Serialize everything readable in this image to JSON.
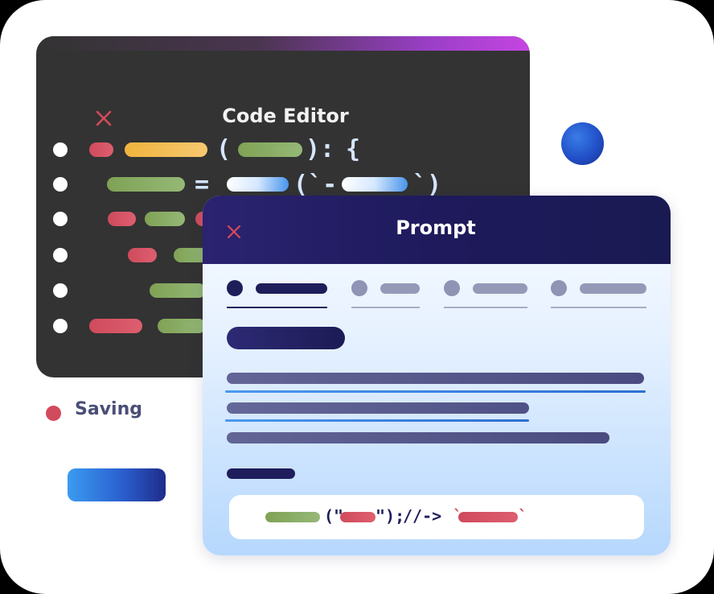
{
  "editor": {
    "title": "Code Editor",
    "close_icon": "close-icon",
    "accent_gradient": [
      "#333333",
      "#c545e2"
    ],
    "lines": [
      {
        "symbols": [
          "(",
          "):",
          "{"
        ]
      },
      {
        "symbols": [
          "=",
          "(`-",
          "`)"
        ]
      },
      {
        "symbols": []
      },
      {
        "symbols": []
      },
      {
        "symbols": []
      },
      {
        "symbols": []
      }
    ]
  },
  "status": {
    "label": "Saving",
    "dot_color": "#d24b5c"
  },
  "prompt": {
    "title": "Prompt",
    "close_icon": "close-icon",
    "header_color": "#1e1a5c",
    "tabs": [
      {
        "state": "active"
      },
      {
        "state": "inactive"
      },
      {
        "state": "inactive"
      },
      {
        "state": "inactive"
      }
    ],
    "code_snippet": {
      "open": "(\"",
      "close": "\");",
      "comment": "//->",
      "tick_open": "`",
      "tick_close": "`"
    }
  }
}
